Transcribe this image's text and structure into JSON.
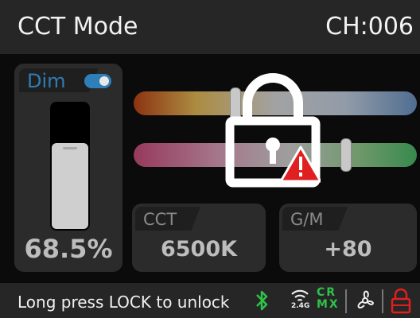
{
  "header": {
    "title": "CCT Mode",
    "channel": "CH:006"
  },
  "dim": {
    "label": "Dim",
    "toggle_on": true,
    "level_fraction": 0.685,
    "value": "68.5%"
  },
  "sliders": {
    "cct_position_fraction": 0.37,
    "gm_position_fraction": 0.76
  },
  "cct": {
    "label": "CCT",
    "value": "6500K"
  },
  "gm": {
    "label": "G/M",
    "value": "+80"
  },
  "lock": {
    "icon": "padlock-locked",
    "warning_icon": "warning-triangle",
    "warning_color": "#e02020"
  },
  "status_bar": {
    "message": "Long press LOCK to unlock",
    "wireless_band": "2.4G",
    "crmx_line1": "CR",
    "crmx_line2": "MX",
    "icons": [
      "bluetooth-icon",
      "wifi-2.4g-icon",
      "crmx-icon",
      "fan-icon",
      "lock-icon"
    ],
    "accent_green": "#2ec24a",
    "lock_red": "#e02020"
  }
}
